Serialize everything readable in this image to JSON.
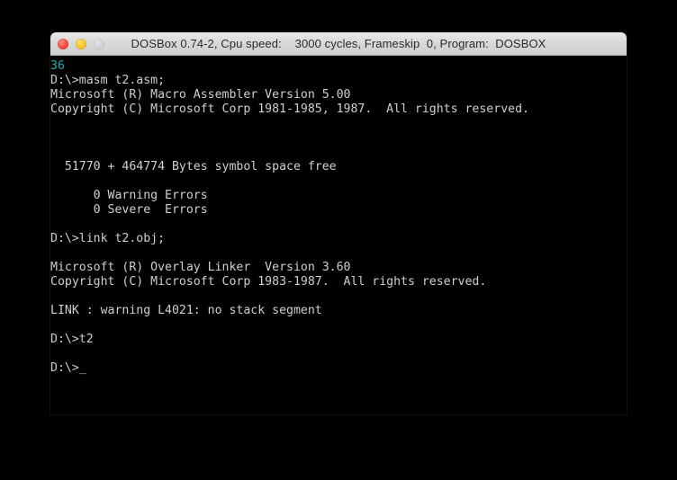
{
  "window": {
    "title": "DOSBox 0.74-2, Cpu speed:    3000 cycles, Frameskip  0, Program:  DOSBOX",
    "controls": {
      "close_label": "close",
      "minimize_label": "minimize",
      "maximize_label": "maximize"
    }
  },
  "terminal": {
    "prompt": "D:\\>",
    "cursor": "_",
    "colors": {
      "background": "#000000",
      "foreground": "#cfcfcf",
      "accent_teal": "#12b4ac"
    },
    "lines": [
      {
        "text": "36",
        "color": "teal"
      },
      {
        "text": "D:\\>masm t2.asm;",
        "color": "white"
      },
      {
        "text": "Microsoft (R) Macro Assembler Version 5.00",
        "color": "white"
      },
      {
        "text": "Copyright (C) Microsoft Corp 1981-1985, 1987.  All rights reserved.",
        "color": "white"
      },
      {
        "text": "",
        "color": "white"
      },
      {
        "text": "",
        "color": "white"
      },
      {
        "text": "",
        "color": "white"
      },
      {
        "text": "  51770 + 464774 Bytes symbol space free",
        "color": "white"
      },
      {
        "text": "",
        "color": "white"
      },
      {
        "text": "      0 Warning Errors",
        "color": "white"
      },
      {
        "text": "      0 Severe  Errors",
        "color": "white"
      },
      {
        "text": "",
        "color": "white"
      },
      {
        "text": "D:\\>link t2.obj;",
        "color": "white"
      },
      {
        "text": "",
        "color": "white"
      },
      {
        "text": "Microsoft (R) Overlay Linker  Version 3.60",
        "color": "white"
      },
      {
        "text": "Copyright (C) Microsoft Corp 1983-1987.  All rights reserved.",
        "color": "white"
      },
      {
        "text": "",
        "color": "white"
      },
      {
        "text": "LINK : warning L4021: no stack segment",
        "color": "white"
      },
      {
        "text": "",
        "color": "white"
      },
      {
        "text": "D:\\>t2",
        "color": "white"
      },
      {
        "text": "",
        "color": "white"
      },
      {
        "text": "D:\\>_",
        "color": "white"
      }
    ]
  }
}
